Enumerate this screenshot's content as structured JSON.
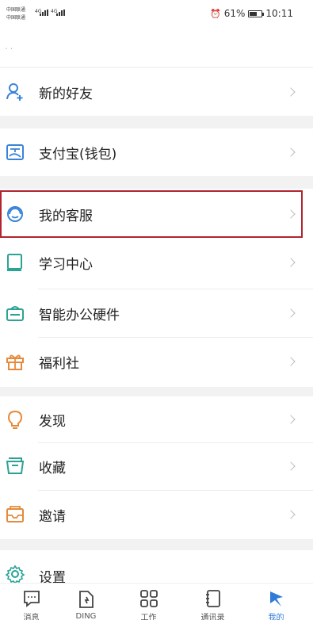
{
  "status_bar": {
    "carrier1": "中国联通",
    "carrier2": "中国联通",
    "net1": "4G",
    "net2": "4G",
    "battery_percent": "61%",
    "battery_level": 0.61,
    "time": "10:11"
  },
  "profile": {
    "placeholder_text": "˙ ˙"
  },
  "menu": {
    "new_friends": "新的好友",
    "alipay": "支付宝(钱包)",
    "customer_service": "我的客服",
    "learning_center": "学习中心",
    "smart_office": "智能办公硬件",
    "welfare": "福利社",
    "discover": "发现",
    "favorites": "收藏",
    "invite": "邀请",
    "settings": "设置"
  },
  "tabs": [
    {
      "label": "消息",
      "icon": "chat-icon"
    },
    {
      "label": "DING",
      "icon": "ding-icon"
    },
    {
      "label": "工作",
      "icon": "grid-icon"
    },
    {
      "label": "通讯录",
      "icon": "contacts-icon"
    },
    {
      "label": "我的",
      "icon": "me-icon"
    }
  ],
  "colors": {
    "accent_blue": "#2f7bd8",
    "highlight_red": "#b1242f",
    "icon_blue": "#3a84d8",
    "icon_teal": "#2aa396",
    "icon_orange": "#e58a3a"
  }
}
